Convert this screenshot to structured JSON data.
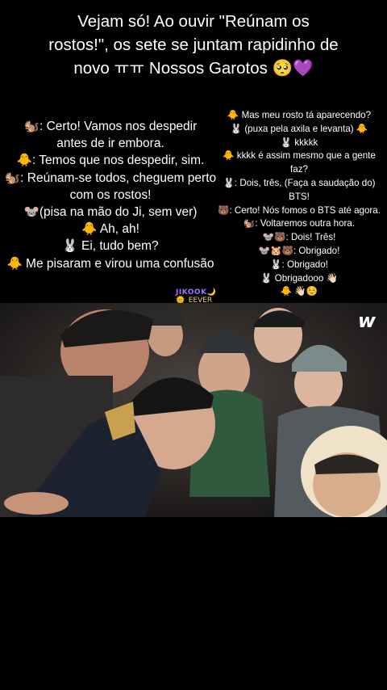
{
  "title": {
    "lines": [
      "Vejam só! Ao ouvir \"Reúnam os",
      "rostos!\", os sete se juntam rapidinho de",
      "novo ㅠㅠ Nossos Garotos 🥺💜"
    ]
  },
  "left_dialogue": [
    "🐿️: Certo! Vamos nos despedir",
    "antes de ir embora.",
    "🐥: Temos que nos despedir, sim.",
    "🐿️: Reúnam-se todos, cheguem perto",
    "com os rostos!",
    "🐭(pisa na mão do Ji, sem ver)",
    "🐥 Ah, ah!",
    "🐰 Ei, tudo bem?",
    "🐥 Me pisaram e virou uma confusão"
  ],
  "right_dialogue": [
    "🐥 Mas meu rosto tá aparecendo?",
    "🐰 (puxa pela axila e levanta) 🐥",
    "🐰 kkkkk",
    "🐥 kkkk é assim mesmo que a gente",
    "faz?",
    "🐰: Dois, três, (Faça a saudação do)",
    "BTS!",
    "🐻: Certo! Nós fomos o BTS até agora.",
    "🐿️: Voltaremos outra hora.",
    "🐭🐻: Dois! Três!",
    "🐭🐹🐻: Obrigado!",
    "🐰: Obrigado!",
    "🐰 Obrigadooo 👋🏻",
    "🐥 👋🏻☺️"
  ],
  "watermark": {
    "line1": "JIKOOK🌙",
    "line2": "🌞_EEVER"
  },
  "photo": {
    "logo": "w",
    "logo_icon": "weverse-logo-icon"
  }
}
